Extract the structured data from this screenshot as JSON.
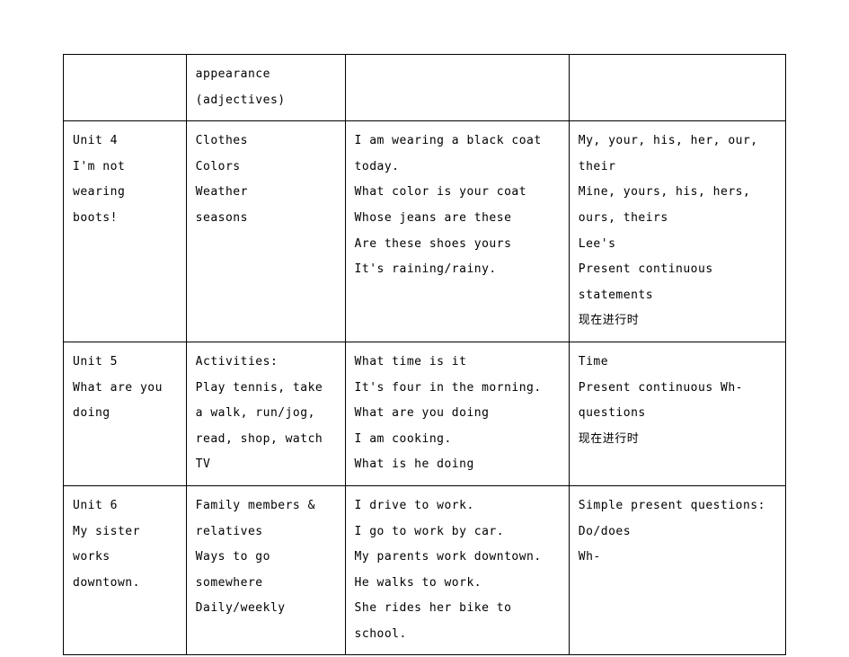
{
  "rows": [
    {
      "col1": [],
      "col2": [
        "appearance",
        "(adjectives)"
      ],
      "col3": [],
      "col4": []
    },
    {
      "col1": [
        "Unit 4",
        "I'm not wearing boots!"
      ],
      "col2": [
        "Clothes",
        "Colors",
        "Weather",
        "seasons"
      ],
      "col3": [
        "I am wearing a black coat today.",
        "What color is your coat",
        "Whose jeans are these",
        "Are these shoes yours",
        "It's raining/rainy."
      ],
      "col4": [
        "My, your, his, her, our, their",
        "Mine, yours, his, hers, ours, theirs",
        "Lee's",
        "",
        "Present continuous statements",
        "现在进行时"
      ]
    },
    {
      "col1": [
        "Unit 5",
        "What are you doing"
      ],
      "col2": [
        "Activities:",
        "Play tennis, take a walk, run/jog, read, shop, watch TV"
      ],
      "col3": [
        "What time is it",
        "It's four in the morning.",
        "What are you doing",
        "I am cooking.",
        "What is he doing"
      ],
      "col4": [
        "Time",
        "",
        "Present continuous Wh-questions",
        "现在进行时"
      ]
    },
    {
      "col1": [
        "Unit 6",
        "My sister works downtown."
      ],
      "col2": [
        "Family members & relatives",
        "",
        "Ways to go somewhere",
        "",
        "Daily/weekly"
      ],
      "col3": [
        "I drive to work.",
        "I go to work by car.",
        "My parents work downtown.",
        "He walks to work.",
        "She rides her bike to school."
      ],
      "col4": [
        "Simple present questions:",
        "Do/does",
        "Wh-"
      ]
    }
  ]
}
